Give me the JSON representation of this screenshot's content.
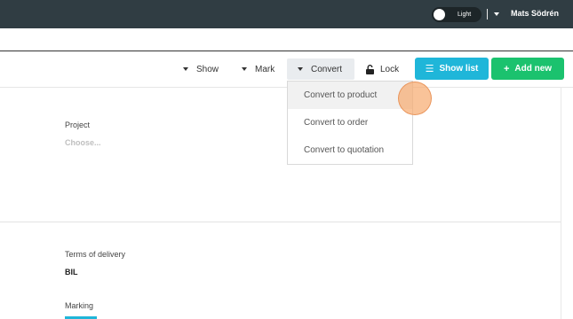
{
  "topbar": {
    "theme_toggle_label": "Light",
    "user_name": "Mats Södrén"
  },
  "toolbar": {
    "show_label": "Show",
    "mark_label": "Mark",
    "convert_label": "Convert",
    "lock_label": "Lock",
    "show_list_label": "Show list",
    "add_new_label": "Add new"
  },
  "convert_menu": {
    "items": [
      "Convert to product",
      "Convert to order",
      "Convert to quotation"
    ]
  },
  "form": {
    "project_label": "Project",
    "project_placeholder": "Choose...",
    "terms_label": "Terms of delivery",
    "terms_value": "BIL",
    "marking_label": "Marking"
  },
  "colors": {
    "topbar": "#303d43",
    "show_list": "#1fb6d9",
    "add_new": "#1bc26e"
  }
}
